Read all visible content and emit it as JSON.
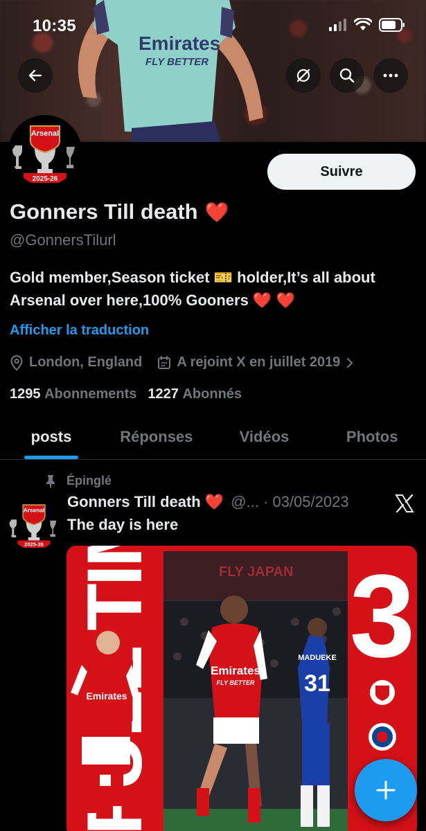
{
  "status": {
    "time": "10:35"
  },
  "profile": {
    "name": "Gonners Till death",
    "name_emoji": "❤️",
    "handle": "@GonnersTilurl",
    "follow_label": "Suivre",
    "bio_line1": "Gold member,Season ticket 🎫 holder,It’s all about",
    "bio_line2": "Arsenal over here,100% Gooners ❤️ ❤️",
    "translate_label": "Afficher la traduction",
    "location": "London, England",
    "joined": "A rejoint X en juillet 2019",
    "following_count": "1295",
    "following_label": "Abonnements",
    "followers_count": "1227",
    "followers_label": "Abonnés",
    "avatar_badge_text": "Arsenal",
    "avatar_season": "2025-26"
  },
  "tabs": [
    {
      "label": "posts",
      "active": true
    },
    {
      "label": "Réponses",
      "active": false
    },
    {
      "label": "Vidéos",
      "active": false
    },
    {
      "label": "Photos",
      "active": false
    }
  ],
  "post": {
    "pinned_label": "Épinglé",
    "author": "Gonners Till death ❤️",
    "meta": "@... · 03/05/2023",
    "text": "The day is here",
    "media": {
      "side_text": "FULL TIME",
      "score": "3",
      "banner_text": "Emirates",
      "banner_text2": "FLY BETTER",
      "opponent_name": "MADUEKE",
      "opponent_number": "31",
      "board_text": "FLY JAPAN"
    }
  },
  "colors": {
    "accent": "#1d9bf0",
    "arsenal_red": "#d51118",
    "background": "#000000",
    "muted": "#71767b"
  }
}
